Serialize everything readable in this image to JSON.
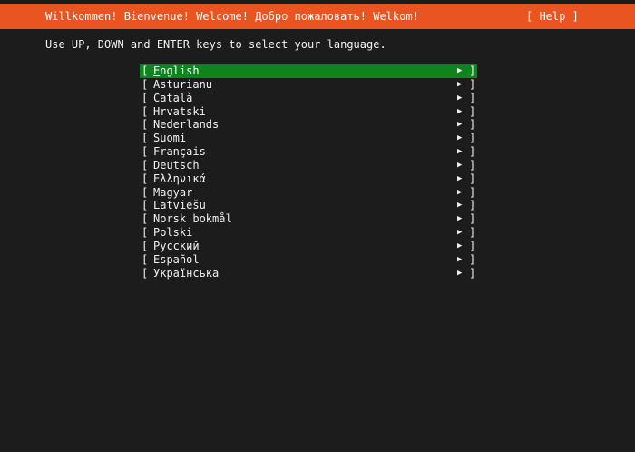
{
  "header": {
    "title": "Willkommen! Bienvenue! Welcome! Добро пожаловать! Welkom!",
    "help_label": "[ Help ]"
  },
  "instructions": "Use UP, DOWN and ENTER keys to select your language.",
  "languages": {
    "bracket_open": "[",
    "bracket_close": "]",
    "arrow": "▶",
    "selected_index": 0,
    "items": [
      "English",
      "Asturianu",
      "Català",
      "Hrvatski",
      "Nederlands",
      "Suomi",
      "Français",
      "Deutsch",
      "Ελληνικά",
      "Magyar",
      "Latviešu",
      "Norsk bokmål",
      "Polski",
      "Русский",
      "Español",
      "Українська"
    ]
  },
  "colors": {
    "header_bg": "#e95420",
    "selected_bg": "#0e8420",
    "background": "#1c1c1c",
    "text": "#f0f0f0"
  }
}
